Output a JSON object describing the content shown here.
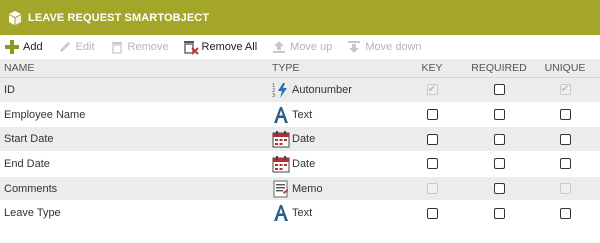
{
  "header": {
    "title": "LEAVE REQUEST SMARTOBJECT",
    "color": "#A4A62A"
  },
  "toolbar": {
    "add": "Add",
    "edit": "Edit",
    "remove": "Remove",
    "remove_all": "Remove All",
    "move_up": "Move up",
    "move_down": "Move down"
  },
  "columns": {
    "name": "NAME",
    "type": "TYPE",
    "key": "KEY",
    "required": "REQUIRED",
    "unique": "UNIQUE"
  },
  "rows": [
    {
      "name": "ID",
      "type": "Autonumber",
      "icon": "autonumber-icon",
      "key": "checked-disabled",
      "required": "unchecked",
      "unique": "checked-disabled"
    },
    {
      "name": "Employee Name",
      "type": "Text",
      "icon": "text-type-icon",
      "key": "unchecked",
      "required": "unchecked",
      "unique": "unchecked"
    },
    {
      "name": "Start Date",
      "type": "Date",
      "icon": "calendar-icon",
      "key": "unchecked",
      "required": "unchecked",
      "unique": "unchecked"
    },
    {
      "name": "End Date",
      "type": "Date",
      "icon": "calendar-icon",
      "key": "unchecked",
      "required": "unchecked",
      "unique": "unchecked"
    },
    {
      "name": "Comments",
      "type": "Memo",
      "icon": "memo-icon",
      "key": "disabled",
      "required": "unchecked",
      "unique": "disabled"
    },
    {
      "name": "Leave Type",
      "type": "Text",
      "icon": "text-type-icon",
      "key": "unchecked",
      "required": "unchecked",
      "unique": "unchecked"
    }
  ]
}
